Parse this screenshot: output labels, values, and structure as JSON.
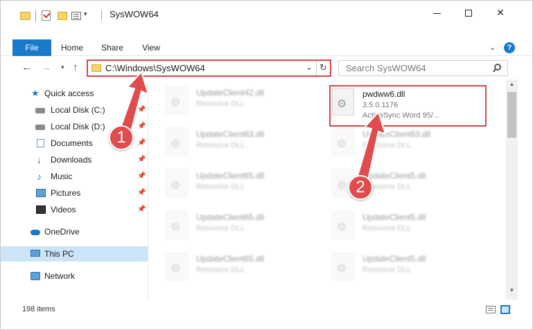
{
  "window": {
    "title": "SysWOW64",
    "qa_dropdown_glyph": "▾",
    "minimize_label": "",
    "close_glyph": "✕"
  },
  "ribbon": {
    "tabs": [
      {
        "label": "File"
      },
      {
        "label": "Home"
      },
      {
        "label": "Share"
      },
      {
        "label": "View"
      }
    ],
    "expand_glyph": "⌄",
    "help_glyph": "?"
  },
  "nav": {
    "back_glyph": "←",
    "forward_glyph": "→",
    "recent_glyph": "▾",
    "up_glyph": "↑"
  },
  "address": {
    "path": "C:\\Windows\\SysWOW64",
    "dropdown_glyph": "⌄",
    "refresh_glyph": "↻"
  },
  "search": {
    "placeholder": "Search SysWOW64"
  },
  "navpane": {
    "items": [
      {
        "label": "Quick access",
        "icon": "star-icon",
        "pinned": false
      },
      {
        "label": "Local Disk (C:)",
        "icon": "drive-icon",
        "pinned": true
      },
      {
        "label": "Local Disk (D:)",
        "icon": "drive-icon",
        "pinned": true
      },
      {
        "label": "Documents",
        "icon": "documents-icon",
        "pinned": true
      },
      {
        "label": "Downloads",
        "icon": "download-icon",
        "pinned": true
      },
      {
        "label": "Music",
        "icon": "music-icon",
        "pinned": true
      },
      {
        "label": "Pictures",
        "icon": "pictures-icon",
        "pinned": true
      },
      {
        "label": "Videos",
        "icon": "videos-icon",
        "pinned": true
      },
      {
        "label": "OneDrive",
        "icon": "cloud-icon",
        "pinned": false
      },
      {
        "label": "This PC",
        "icon": "computer-icon",
        "pinned": false,
        "selected": true
      },
      {
        "label": "Network",
        "icon": "network-icon",
        "pinned": false
      }
    ],
    "pin_glyph": "📌"
  },
  "files": {
    "left_column": [
      {
        "name": "UpdateClient42.dll",
        "desc": "Resource DLL"
      },
      {
        "name": "UpdateClient63.dll",
        "desc": "Resource DLL"
      },
      {
        "name": "UpdateClient65.dll",
        "desc": "Resource DLL"
      },
      {
        "name": "UpdateClient65.dll",
        "desc": "Resource DLL"
      },
      {
        "name": "UpdateClient65.dll",
        "desc": "Resource DLL"
      }
    ],
    "right_column": [
      {
        "name": "pwdww6.dll",
        "desc": "3.5.0.1176",
        "sub": "ActiveSync Word 95/..."
      },
      {
        "name": "UpdateClient63.dll",
        "desc": "Resource DLL"
      },
      {
        "name": "UpdateClient5.dll",
        "desc": "Resource DLL"
      },
      {
        "name": "UpdateClient5.dll",
        "desc": "Resource DLL"
      },
      {
        "name": "UpdateClient5.dll",
        "desc": "Resource DLL"
      }
    ]
  },
  "statusbar": {
    "count": "198 items"
  },
  "annotations": {
    "marker_1": "1",
    "marker_2": "2",
    "accent_color": "#e04b4b"
  },
  "colors": {
    "accent": "#1979ca",
    "highlight": "#d94545",
    "selected_bg": "#cce4f7"
  }
}
